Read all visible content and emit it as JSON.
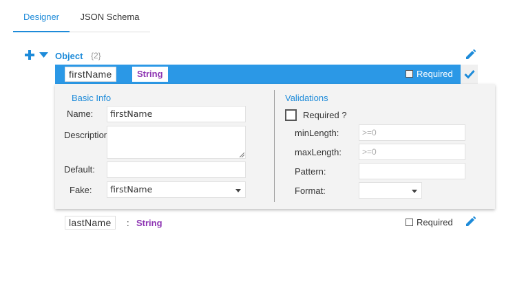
{
  "tabs": [
    {
      "label": "Designer",
      "active": true
    },
    {
      "label": "JSON Schema",
      "active": false
    }
  ],
  "root": {
    "type_label": "Object",
    "count": "{2}"
  },
  "selected_property": {
    "name": "firstName",
    "type": "String",
    "required_label": "Required",
    "required": false
  },
  "panel": {
    "basic_info_title": "Basic Info",
    "validations_title": "Validations",
    "name_label": "Name:",
    "name_value": "firstName",
    "description_label": "Description",
    "description_value": "",
    "default_label": "Default:",
    "default_value": "",
    "fake_label": "Fake:",
    "fake_value": "firstName",
    "required_label": "Required ?",
    "minlength_label": "minLength:",
    "minlength_placeholder": ">=0",
    "maxlength_label": "maxLength:",
    "maxlength_placeholder": ">=0",
    "pattern_label": "Pattern:",
    "pattern_value": "",
    "format_label": "Format:",
    "format_value": ""
  },
  "other_property": {
    "name": "lastName",
    "separator": ":",
    "type": "String",
    "required_label": "Required",
    "required": false
  },
  "colors": {
    "accent": "#1e8bd9",
    "selected_bar": "#2b98e6",
    "type_color": "#8e35b3",
    "panel_bg": "#f3f3f3"
  }
}
